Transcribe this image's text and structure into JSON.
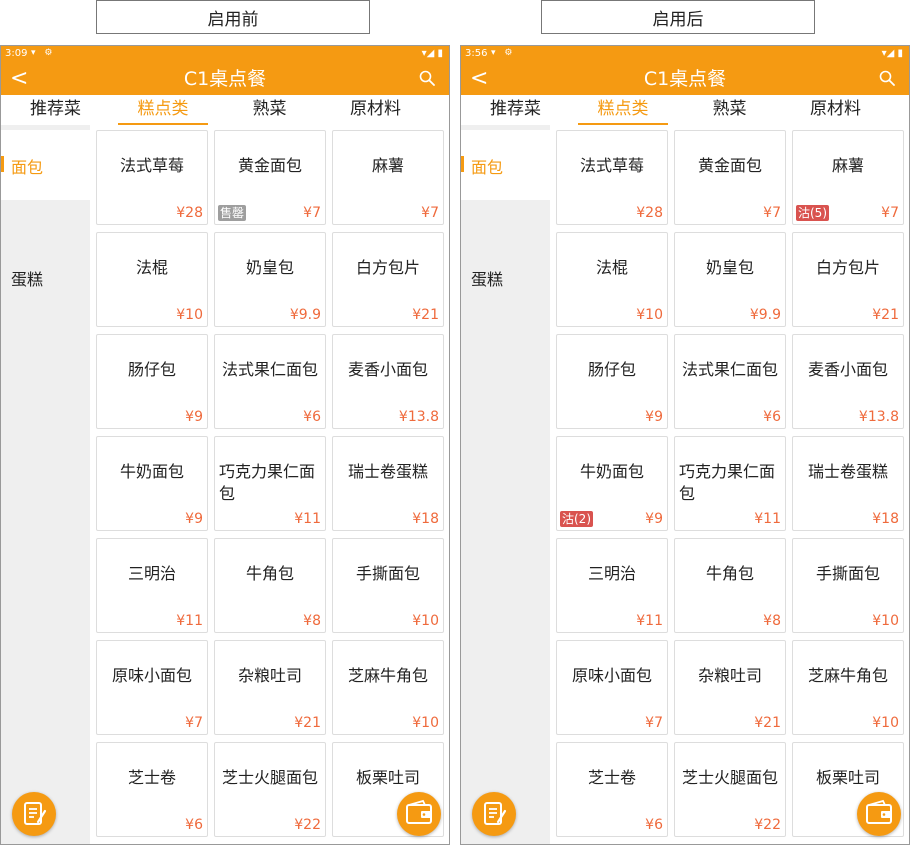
{
  "captions": {
    "left": "启用前",
    "right": "启用后"
  },
  "colors": {
    "accent": "#f59a12",
    "price": "#ef6a3c",
    "sidebar_bg": "#efefef",
    "badge_gray": "#9e9e9e",
    "badge_red": "#d9534f"
  },
  "phones": [
    {
      "status": {
        "time": "3:09",
        "left_icons": "▾ ⚙",
        "right_icons": "▾◢ ▮"
      },
      "title": "C1桌点餐",
      "back_icon": "<",
      "tabs": [
        {
          "label": "推荐菜"
        },
        {
          "label": "糕点类"
        },
        {
          "label": "熟菜"
        },
        {
          "label": "原材料"
        }
      ],
      "categories": [
        {
          "label": "面包"
        },
        {
          "label": "蛋糕"
        }
      ],
      "items": [
        {
          "name": "法式草莓",
          "price": "¥28",
          "badge": ""
        },
        {
          "name": "黄金面包",
          "price": "¥7",
          "badge": "售罄"
        },
        {
          "name": "麻薯",
          "price": "¥7",
          "badge": ""
        },
        {
          "name": "法棍",
          "price": "¥10",
          "badge": ""
        },
        {
          "name": "奶皇包",
          "price": "¥9.9",
          "badge": ""
        },
        {
          "name": "白方包片",
          "price": "¥21",
          "badge": ""
        },
        {
          "name": "肠仔包",
          "price": "¥9",
          "badge": ""
        },
        {
          "name": "法式果仁面包",
          "price": "¥6",
          "badge": ""
        },
        {
          "name": "麦香小面包",
          "price": "¥13.8",
          "badge": ""
        },
        {
          "name": "牛奶面包",
          "price": "¥9",
          "badge": ""
        },
        {
          "name": "巧克力果仁面包",
          "price": "¥11",
          "badge": ""
        },
        {
          "name": "瑞士卷蛋糕",
          "price": "¥18",
          "badge": ""
        },
        {
          "name": "三明治",
          "price": "¥11",
          "badge": ""
        },
        {
          "name": "牛角包",
          "price": "¥8",
          "badge": ""
        },
        {
          "name": "手撕面包",
          "price": "¥10",
          "badge": ""
        },
        {
          "name": "原味小面包",
          "price": "¥7",
          "badge": ""
        },
        {
          "name": "杂粮吐司",
          "price": "¥21",
          "badge": ""
        },
        {
          "name": "芝麻牛角包",
          "price": "¥10",
          "badge": ""
        },
        {
          "name": "芝士卷",
          "price": "¥6",
          "badge": ""
        },
        {
          "name": "芝士火腿面包",
          "price": "¥22",
          "badge": ""
        },
        {
          "name": "板栗吐司",
          "price": "",
          "badge": ""
        }
      ],
      "fab_left_icon": "order-list-icon",
      "fab_right_icon": "wallet-icon"
    },
    {
      "status": {
        "time": "3:56",
        "left_icons": "▾ ⚙",
        "right_icons": "▾◢ ▮"
      },
      "title": "C1桌点餐",
      "back_icon": "<",
      "tabs": [
        {
          "label": "推荐菜"
        },
        {
          "label": "糕点类"
        },
        {
          "label": "熟菜"
        },
        {
          "label": "原材料"
        }
      ],
      "categories": [
        {
          "label": "面包"
        },
        {
          "label": "蛋糕"
        }
      ],
      "items": [
        {
          "name": "法式草莓",
          "price": "¥28",
          "badge": ""
        },
        {
          "name": "黄金面包",
          "price": "¥7",
          "badge": ""
        },
        {
          "name": "麻薯",
          "price": "¥7",
          "badge": "沽(5)"
        },
        {
          "name": "法棍",
          "price": "¥10",
          "badge": ""
        },
        {
          "name": "奶皇包",
          "price": "¥9.9",
          "badge": ""
        },
        {
          "name": "白方包片",
          "price": "¥21",
          "badge": ""
        },
        {
          "name": "肠仔包",
          "price": "¥9",
          "badge": ""
        },
        {
          "name": "法式果仁面包",
          "price": "¥6",
          "badge": ""
        },
        {
          "name": "麦香小面包",
          "price": "¥13.8",
          "badge": ""
        },
        {
          "name": "牛奶面包",
          "price": "¥9",
          "badge": "沽(2)"
        },
        {
          "name": "巧克力果仁面包",
          "price": "¥11",
          "badge": ""
        },
        {
          "name": "瑞士卷蛋糕",
          "price": "¥18",
          "badge": ""
        },
        {
          "name": "三明治",
          "price": "¥11",
          "badge": ""
        },
        {
          "name": "牛角包",
          "price": "¥8",
          "badge": ""
        },
        {
          "name": "手撕面包",
          "price": "¥10",
          "badge": ""
        },
        {
          "name": "原味小面包",
          "price": "¥7",
          "badge": ""
        },
        {
          "name": "杂粮吐司",
          "price": "¥21",
          "badge": ""
        },
        {
          "name": "芝麻牛角包",
          "price": "¥10",
          "badge": ""
        },
        {
          "name": "芝士卷",
          "price": "¥6",
          "badge": ""
        },
        {
          "name": "芝士火腿面包",
          "price": "¥22",
          "badge": ""
        },
        {
          "name": "板栗吐司",
          "price": "",
          "badge": ""
        }
      ],
      "fab_left_icon": "order-list-icon",
      "fab_right_icon": "wallet-icon"
    }
  ]
}
